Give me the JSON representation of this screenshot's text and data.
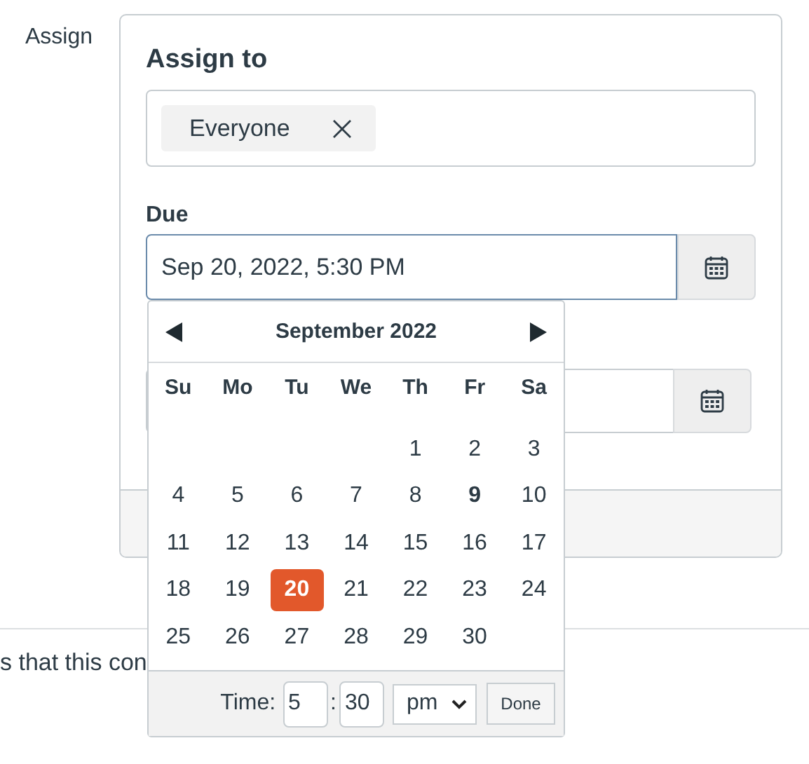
{
  "section_label": "Assign",
  "assign_to": {
    "label": "Assign to",
    "tags": [
      {
        "text": "Everyone"
      }
    ]
  },
  "due": {
    "label": "Due",
    "value": "Sep 20, 2022, 5:30 PM"
  },
  "calendar": {
    "month": "September 2022",
    "weekdays": [
      "Su",
      "Mo",
      "Tu",
      "We",
      "Th",
      "Fr",
      "Sa"
    ],
    "weeks": [
      {
        "kind": "first",
        "days": [
          {
            "day": "1",
            "selected": false,
            "today": false
          },
          {
            "day": "2",
            "selected": false,
            "today": false
          },
          {
            "day": "3",
            "selected": false,
            "today": false
          }
        ]
      },
      {
        "kind": "regular",
        "days": [
          {
            "day": "4",
            "selected": false,
            "today": false
          },
          {
            "day": "5",
            "selected": false,
            "today": false
          },
          {
            "day": "6",
            "selected": false,
            "today": false
          },
          {
            "day": "7",
            "selected": false,
            "today": false
          },
          {
            "day": "8",
            "selected": false,
            "today": false
          },
          {
            "day": "9",
            "selected": false,
            "today": true
          },
          {
            "day": "10",
            "selected": false,
            "today": false
          }
        ]
      },
      {
        "kind": "regular",
        "days": [
          {
            "day": "11",
            "selected": false,
            "today": false
          },
          {
            "day": "12",
            "selected": false,
            "today": false
          },
          {
            "day": "13",
            "selected": false,
            "today": false
          },
          {
            "day": "14",
            "selected": false,
            "today": false
          },
          {
            "day": "15",
            "selected": false,
            "today": false
          },
          {
            "day": "16",
            "selected": false,
            "today": false
          },
          {
            "day": "17",
            "selected": false,
            "today": false
          }
        ]
      },
      {
        "kind": "regular",
        "days": [
          {
            "day": "18",
            "selected": false,
            "today": false
          },
          {
            "day": "19",
            "selected": false,
            "today": false
          },
          {
            "day": "20",
            "selected": true,
            "today": false
          },
          {
            "day": "21",
            "selected": false,
            "today": false
          },
          {
            "day": "22",
            "selected": false,
            "today": false
          },
          {
            "day": "23",
            "selected": false,
            "today": false
          },
          {
            "day": "24",
            "selected": false,
            "today": false
          }
        ]
      },
      {
        "kind": "regular",
        "days": [
          {
            "day": "25",
            "selected": false,
            "today": false
          },
          {
            "day": "26",
            "selected": false,
            "today": false
          },
          {
            "day": "27",
            "selected": false,
            "today": false
          },
          {
            "day": "28",
            "selected": false,
            "today": false
          },
          {
            "day": "29",
            "selected": false,
            "today": false
          },
          {
            "day": "30",
            "selected": false,
            "today": false
          }
        ]
      }
    ],
    "time": {
      "label": "Time:",
      "hour": "5",
      "separator": ":",
      "minute": "30",
      "meridiem": "pm",
      "done": "Done"
    }
  },
  "footer_text": "s that this con"
}
